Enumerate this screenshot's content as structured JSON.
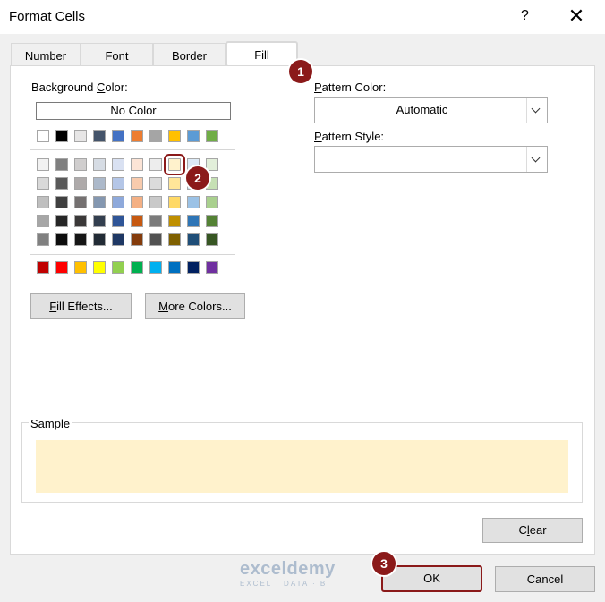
{
  "window": {
    "title": "Format Cells",
    "help": "?",
    "close": "✕"
  },
  "tabs": [
    {
      "label": "Number",
      "active": false
    },
    {
      "label": "Font",
      "active": false
    },
    {
      "label": "Border",
      "active": false
    },
    {
      "label": "Fill",
      "active": true
    }
  ],
  "background_color": {
    "label_pre": "Background ",
    "label_key": "C",
    "label_post": "olor:",
    "no_color": "No Color",
    "theme_top_row": [
      "#ffffff",
      "#000000",
      "#e7e6e6",
      "#44546a",
      "#4472c4",
      "#ed7d31",
      "#a5a5a5",
      "#ffc000",
      "#5b9bd5",
      "#70ad47"
    ],
    "theme_shades": [
      [
        "#f2f2f2",
        "#7f7f7f",
        "#d0cece",
        "#d6dce4",
        "#d9e1f2",
        "#fce4d6",
        "#ededed",
        "#fff2cc",
        "#ddebf7",
        "#e2efda"
      ],
      [
        "#d9d9d9",
        "#595959",
        "#aeaaaa",
        "#acb9ca",
        "#b4c6e7",
        "#f8cbad",
        "#dbdbdb",
        "#ffe699",
        "#bdd7ee",
        "#c6e0b4"
      ],
      [
        "#bfbfbf",
        "#404040",
        "#757171",
        "#8497b0",
        "#8ea9db",
        "#f4b084",
        "#c9c9c9",
        "#ffd966",
        "#9bc2e6",
        "#a9d08e"
      ],
      [
        "#a6a6a6",
        "#262626",
        "#3a3838",
        "#333f4f",
        "#2f5597",
        "#c65911",
        "#7b7b7b",
        "#bf8f00",
        "#2e75b6",
        "#548235"
      ],
      [
        "#808080",
        "#0d0d0d",
        "#161616",
        "#222b35",
        "#1f3864",
        "#843c0c",
        "#525252",
        "#7f6000",
        "#1f4e78",
        "#375623"
      ]
    ],
    "standard_colors": [
      "#c00000",
      "#ff0000",
      "#ffc000",
      "#ffff00",
      "#92d050",
      "#00b050",
      "#00b0f0",
      "#0070c0",
      "#002060",
      "#7030a0"
    ],
    "selected": {
      "row": 0,
      "col": 7
    }
  },
  "buttons": {
    "fill_effects_key": "F",
    "fill_effects_rest": "ill Effects...",
    "more_colors_key": "M",
    "more_colors_rest": "ore Colors...",
    "clear_pre": "C",
    "clear_key": "l",
    "clear_post": "ear",
    "ok": "OK",
    "cancel": "Cancel"
  },
  "pattern_color": {
    "label_key": "P",
    "label_rest": "attern Color:",
    "value": "Automatic"
  },
  "pattern_style": {
    "label_key": "P",
    "label_rest": "attern Style:",
    "value": ""
  },
  "sample": {
    "label": "Sample",
    "fill_color": "#fff2cc"
  },
  "badges": [
    "1",
    "2",
    "3"
  ],
  "watermark": {
    "name": "exceldemy",
    "sub": "EXCEL · DATA · BI"
  }
}
